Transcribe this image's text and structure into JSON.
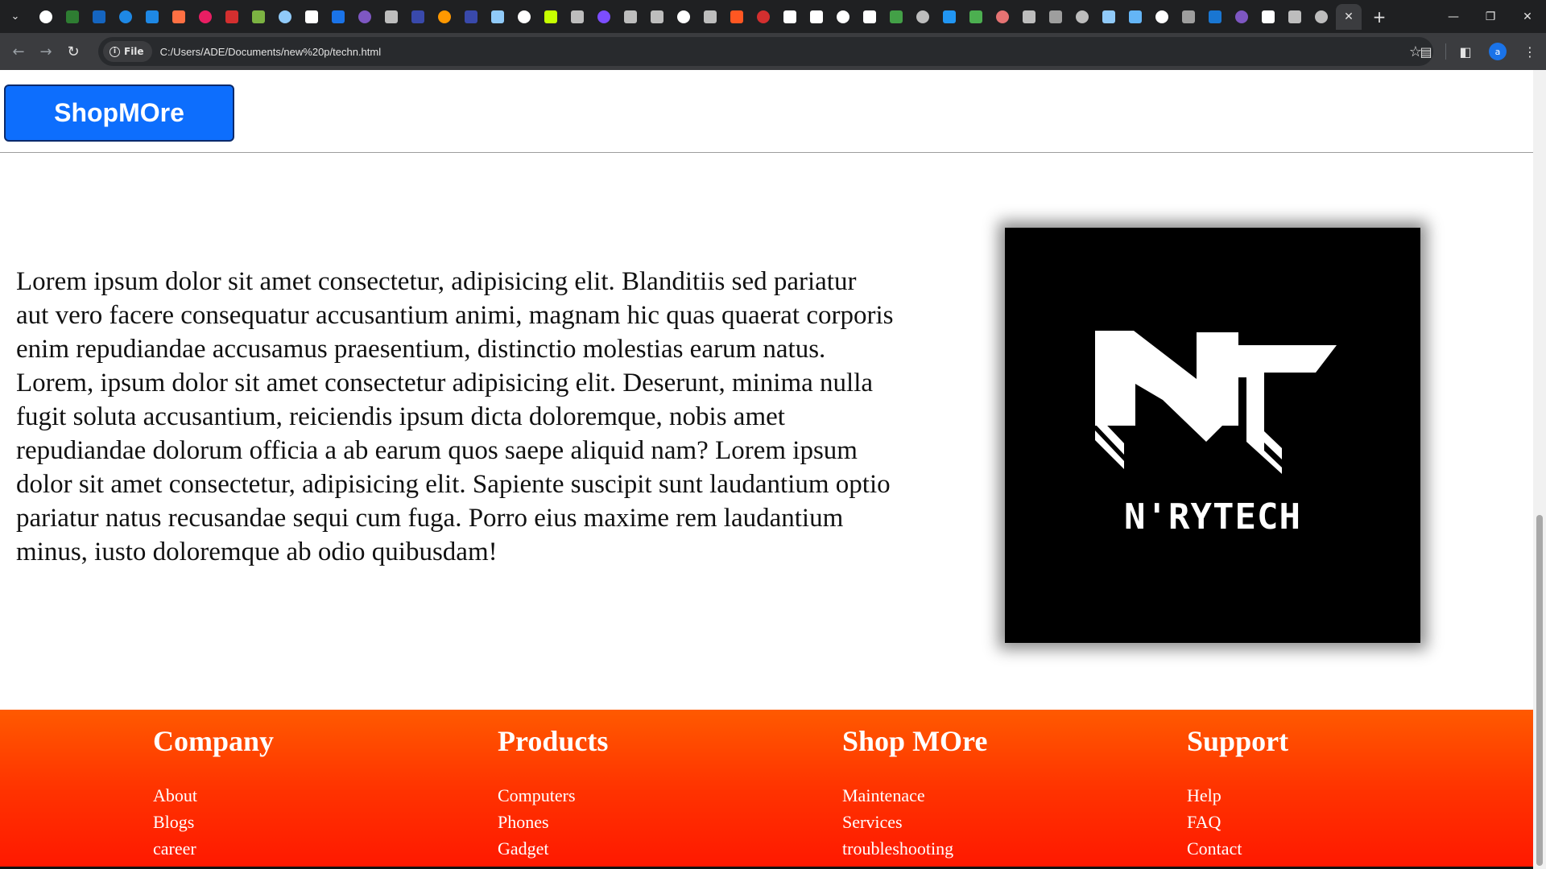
{
  "browser": {
    "url": "C:/Users/ADE/Documents/new%20p/techn.html",
    "site_chip_label": "File",
    "profile_initial": "a",
    "pinned_tab_colors": [
      "#ffffff",
      "#2e7d32",
      "#1565c0",
      "#1e88e5",
      "#1e88e5",
      "#ff7043",
      "#e91e63",
      "#d32f2f",
      "#7cb342",
      "#90caf9",
      "#ffffff",
      "#1a73e8",
      "#7e57c2",
      "#bdbdbd",
      "#3949ab",
      "#ff9800",
      "#3949ab",
      "#90caf9",
      "#ffffff",
      "#c6ff00",
      "#bdbdbd",
      "#7c4dff",
      "#bdbdbd",
      "#bdbdbd",
      "#ffffff",
      "#bdbdbd",
      "#ff5722",
      "#d32f2f",
      "#ffffff",
      "#ffffff",
      "#ffffff",
      "#ffffff",
      "#43a047",
      "#bdbdbd",
      "#2196f3",
      "#4caf50",
      "#e57373",
      "#bdbdbd",
      "#9e9e9e",
      "#bdbdbd",
      "#90caf9",
      "#64b5f6",
      "#ffffff",
      "#9e9e9e",
      "#1976d2",
      "#7e57c2",
      "#ffffff",
      "#bdbdbd",
      "#bdbdbd"
    ]
  },
  "header": {
    "brand_label": "ShopMOre"
  },
  "hero": {
    "paragraph": "Lorem ipsum dolor sit amet consectetur, adipisicing elit. Blanditiis sed pariatur aut vero facere consequatur accusantium animi, magnam hic quas quaerat corporis enim repudiandae accusamus praesentium, distinctio molestias earum natus. Lorem, ipsum dolor sit amet consectetur adipisicing elit. Deserunt, minima nulla fugit soluta accusantium, reiciendis ipsum dicta doloremque, nobis amet repudiandae dolorum officia a ab earum quos saepe aliquid nam? Lorem ipsum dolor sit amet consectetur, adipisicing elit. Sapiente suscipit sunt laudantium optio pariatur natus recusandae sequi cum fuga. Porro eius maxime rem laudantium minus, iusto doloremque ab odio quibusdam!",
    "logo_text": "N'RYTECH"
  },
  "footer": {
    "columns": [
      {
        "title": "Company",
        "links": [
          "About",
          "Blogs",
          "career"
        ]
      },
      {
        "title": "Products",
        "links": [
          "Computers",
          "Phones",
          "Gadget"
        ]
      },
      {
        "title": "Shop MOre",
        "links": [
          "Maintenace",
          "Services",
          "troubleshooting"
        ]
      },
      {
        "title": "Support",
        "links": [
          "Help",
          "FAQ",
          "Contact"
        ]
      }
    ],
    "gradient_top": "#ff5a00",
    "gradient_bottom": "#ff1800"
  },
  "colors": {
    "brand_button": "#0d6efd",
    "chrome_dark": "#1f2022",
    "chrome_toolbar": "#3b3c3f"
  }
}
